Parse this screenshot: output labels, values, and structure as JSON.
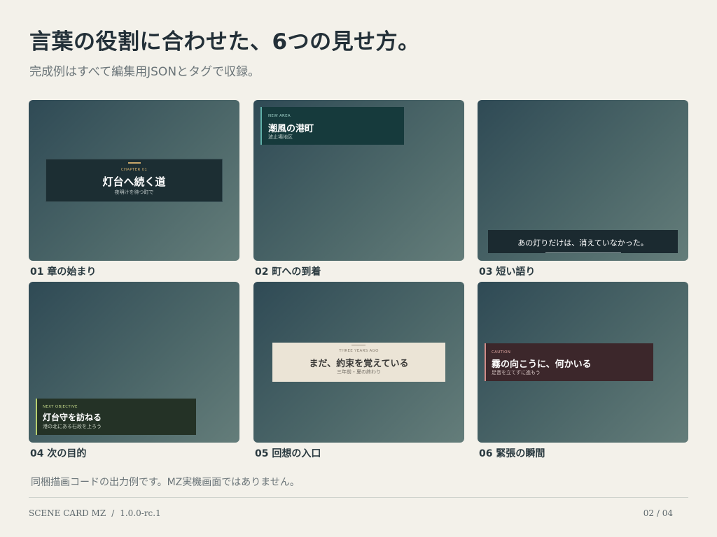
{
  "header": {
    "title": "言葉の役割に合わせた、6つの見せ方。",
    "subtitle": "完成例はすべて編集用JSONとタグで収録。"
  },
  "examples": [
    {
      "caption": "01 章の始まり",
      "card": {
        "eyebrow": "CHAPTER 01",
        "title": "灯台へ続く道",
        "sub": "夜明けを待つ町で"
      }
    },
    {
      "caption": "02 町への到着",
      "card": {
        "eyebrow": "NEW AREA",
        "title": "潮風の港町",
        "sub": "波止場地区"
      }
    },
    {
      "caption": "03 短い語り",
      "card": {
        "line": "あの灯りだけは、消えていなかった。"
      }
    },
    {
      "caption": "04 次の目的",
      "card": {
        "eyebrow": "NEXT OBJECTIVE",
        "title": "灯台守を訪ねる",
        "sub": "港の北にある石段を上ろう"
      }
    },
    {
      "caption": "05 回想の入口",
      "card": {
        "eyebrow": "THREE YEARS AGO",
        "title": "まだ、約束を覚えている",
        "sub": "三年前・夏の終わり"
      }
    },
    {
      "caption": "06 緊張の瞬間",
      "card": {
        "eyebrow": "CAUTION",
        "title": "霧の向こうに、何かいる",
        "sub": "足音を立てずに進もう"
      }
    }
  ],
  "note": "同梱描画コードの出力例です。MZ実機画面ではありません。",
  "footer": {
    "product": "SCENE CARD MZ",
    "separator": "/",
    "version": "1.0.0-rc.1",
    "page": "02 / 04"
  },
  "colors": {
    "background": "#f3f1ea",
    "chapter_accent": "#c9a86a",
    "area_accent": "#5fb0a8",
    "objective_accent": "#b8cf6e",
    "caution_accent": "#d28a86"
  }
}
